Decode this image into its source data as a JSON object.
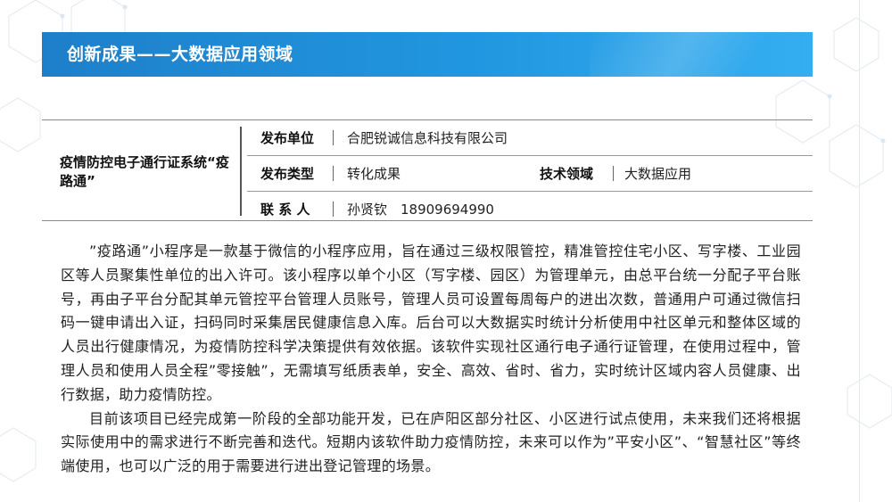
{
  "banner": {
    "title": "创新成果——大数据应用领域"
  },
  "project": {
    "title": "疫情防控电子通行证系统“疫路通”"
  },
  "info": {
    "publisher_label": "发布单位",
    "publisher_value": "合肥锐诚信息科技有限公司",
    "type_label": "发布类型",
    "type_value": "转化成果",
    "field_label": "技术领域",
    "field_value": "大数据应用",
    "contact_label": "联 系 人",
    "contact_value": "孙贤钦　18909694990"
  },
  "body": {
    "paragraphs": [
      "”疫路通”小程序是一款基于微信的小程序应用，旨在通过三级权限管控，精准管控住宅小区、写字楼、工业园区等人员聚集性单位的出入许可。该小程序以单个小区（写字楼、园区）为管理单元，由总平台统一分配子平台账号，再由子平台分配其单元管控平台管理人员账号，管理人员可设置每周每户的进出次数，普通用户可通过微信扫码一键申请出入证，扫码同时采集居民健康信息入库。后台可以大数据实时统计分析使用中社区单元和整体区域的人员出行健康情况，为疫情防控科学决策提供有效依据。该软件实现社区通行电子通行证管理，在使用过程中，管理人员和使用人员全程”零接触”，无需填写纸质表单，安全、高效、省时、省力，实时统计区域内容人员健康、出行数据，助力疫情防控。",
      "目前该项目已经完成第一阶段的全部功能开发，已在庐阳区部分社区、小区进行试点使用，未来我们还将根据实际使用中的需求进行不断完善和迭代。短期内该软件助力疫情防控，未来可以作为”平安小区”、“智慧社区”等终端使用，也可以广泛的用于需要进行进出登记管理的场景。"
    ]
  },
  "colors": {
    "banner": "#2196e0",
    "banner_dark": "#1e7fc9"
  }
}
